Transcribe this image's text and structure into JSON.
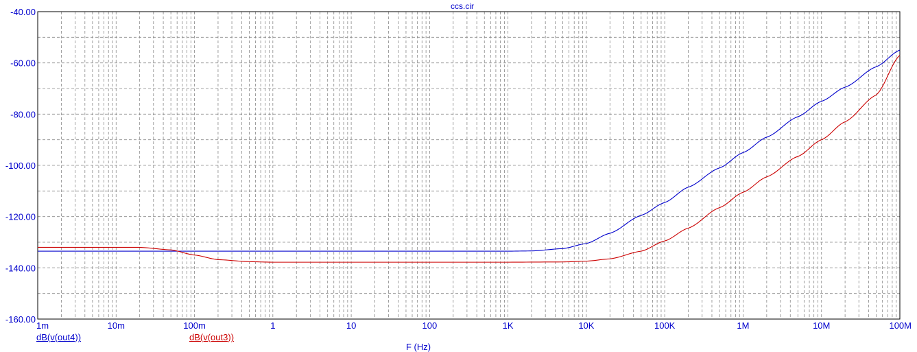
{
  "chart_data": {
    "type": "line",
    "title": "ccs.cir",
    "xlabel": "F (Hz)",
    "ylabel": "",
    "x_scale": "log",
    "xlim": [
      0.001,
      10000000
    ],
    "ylim": [
      -160,
      -40
    ],
    "grid": true,
    "x_ticks": [
      {
        "value": 0.001,
        "label": "1m"
      },
      {
        "value": 0.01,
        "label": "10m"
      },
      {
        "value": 0.1,
        "label": "100m"
      },
      {
        "value": 1,
        "label": "1"
      },
      {
        "value": 10,
        "label": "10"
      },
      {
        "value": 100,
        "label": "100"
      },
      {
        "value": 1000,
        "label": "1K"
      },
      {
        "value": 10000,
        "label": "10K"
      },
      {
        "value": 100000,
        "label": "100K"
      },
      {
        "value": 1000000,
        "label": "1M"
      },
      {
        "value": 10000000,
        "label": "10M"
      },
      {
        "value": 100000000,
        "label": "100M"
      }
    ],
    "y_ticks": [
      {
        "value": -40,
        "label": "-40.00"
      },
      {
        "value": -60,
        "label": "-60.00"
      },
      {
        "value": -80,
        "label": "-80.00"
      },
      {
        "value": -100,
        "label": "-100.00"
      },
      {
        "value": -120,
        "label": "-120.00"
      },
      {
        "value": -140,
        "label": "-140.00"
      },
      {
        "value": -160,
        "label": "-160.00"
      }
    ],
    "series": [
      {
        "name": "dB(v(out4))",
        "color": "#0000cc",
        "points": [
          [
            0.001,
            -133.5
          ],
          [
            1000,
            -133.5
          ],
          [
            2000,
            -133.4
          ],
          [
            5000,
            -132.5
          ],
          [
            10000,
            -130.5
          ],
          [
            20000,
            -126.5
          ],
          [
            50000,
            -119.5
          ],
          [
            100000,
            -114.5
          ],
          [
            200000,
            -108.5
          ],
          [
            500000,
            -101
          ],
          [
            1000000,
            -95
          ],
          [
            2000000,
            -89
          ],
          [
            5000000,
            -81
          ],
          [
            10000000,
            -75
          ],
          [
            20000000,
            -69.5
          ],
          [
            50000000,
            -61.5
          ],
          [
            100000000,
            -55
          ]
        ]
      },
      {
        "name": "dB(v(out3))",
        "color": "#cc0000",
        "points": [
          [
            0.001,
            -132
          ],
          [
            0.02,
            -132
          ],
          [
            0.05,
            -133
          ],
          [
            0.1,
            -135
          ],
          [
            0.2,
            -136.8
          ],
          [
            0.5,
            -137.6
          ],
          [
            1,
            -137.8
          ],
          [
            10,
            -137.8
          ],
          [
            1000,
            -137.8
          ],
          [
            5000,
            -137.7
          ],
          [
            10000,
            -137.4
          ],
          [
            20000,
            -136.5
          ],
          [
            50000,
            -133.5
          ],
          [
            100000,
            -129.5
          ],
          [
            200000,
            -124.5
          ],
          [
            500000,
            -116.5
          ],
          [
            1000000,
            -110.5
          ],
          [
            2000000,
            -104.5
          ],
          [
            5000000,
            -96.5
          ],
          [
            10000000,
            -90
          ],
          [
            20000000,
            -83
          ],
          [
            50000000,
            -72.5
          ],
          [
            100000000,
            -57
          ]
        ]
      }
    ]
  },
  "colors": {
    "axis_text": "#0000cc",
    "grid": "#888888",
    "frame": "#000000"
  }
}
